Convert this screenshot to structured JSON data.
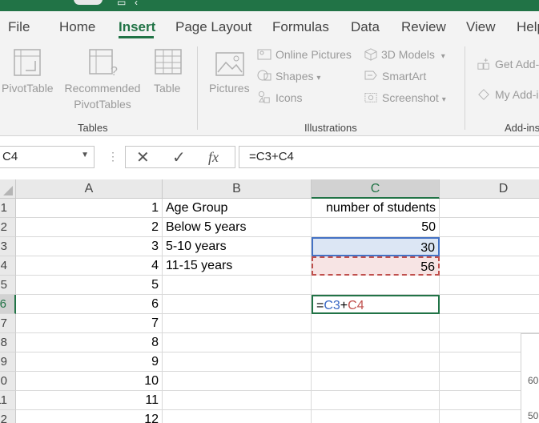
{
  "menu": {
    "tabs": [
      "File",
      "Home",
      "Insert",
      "Page Layout",
      "Formulas",
      "Data",
      "Review",
      "View",
      "Help"
    ],
    "active": "Insert"
  },
  "ribbon": {
    "tables": {
      "label": "Tables",
      "pivot_table": "PivotTable",
      "recommended_1": "Recommended",
      "recommended_2": "PivotTables",
      "table": "Table"
    },
    "illustrations": {
      "label": "Illustrations",
      "pictures": "Pictures",
      "online_pictures": "Online Pictures",
      "shapes": "Shapes",
      "icons": "Icons",
      "models_3d": "3D Models",
      "smartart": "SmartArt",
      "screenshot": "Screenshot"
    },
    "addins": {
      "label": "Add-ins",
      "get_addins": "Get Add-ins",
      "my_addins": "My Add-ins"
    }
  },
  "formula_bar": {
    "name_box": "C4",
    "fx": "fx",
    "formula": "=C3+C4"
  },
  "sheet": {
    "columns": [
      "A",
      "B",
      "C",
      "D"
    ],
    "selected_column": "C",
    "rows": [
      {
        "num": "1",
        "a": "1",
        "b": "Age Group",
        "c": "number of students"
      },
      {
        "num": "2",
        "a": "2",
        "b": "Below 5 years",
        "c": "50"
      },
      {
        "num": "3",
        "a": "3",
        "b": "5-10 years",
        "c": "30"
      },
      {
        "num": "4",
        "a": "4",
        "b": "11-15 years",
        "c": "56"
      },
      {
        "num": "5",
        "a": "5",
        "b": "",
        "c": ""
      },
      {
        "num": "6",
        "a": "6",
        "b": "",
        "c": ""
      },
      {
        "num": "7",
        "a": "7",
        "b": "",
        "c": ""
      },
      {
        "num": "8",
        "a": "8",
        "b": "",
        "c": ""
      },
      {
        "num": "9",
        "a": "9",
        "b": "",
        "c": ""
      },
      {
        "num": "10",
        "a": "10",
        "b": "",
        "c": ""
      },
      {
        "num": "11",
        "a": "11",
        "b": "",
        "c": ""
      },
      {
        "num": "12",
        "a": "12",
        "b": "",
        "c": ""
      }
    ],
    "editing_cell": {
      "eq": "=",
      "ref1": "C3",
      "plus": "+",
      "ref2": "C4"
    },
    "chart_ticks": [
      "60",
      "50"
    ]
  },
  "colors": {
    "accent": "#217346",
    "ref_blue": "#4472c4",
    "ref_red": "#c0504d"
  }
}
